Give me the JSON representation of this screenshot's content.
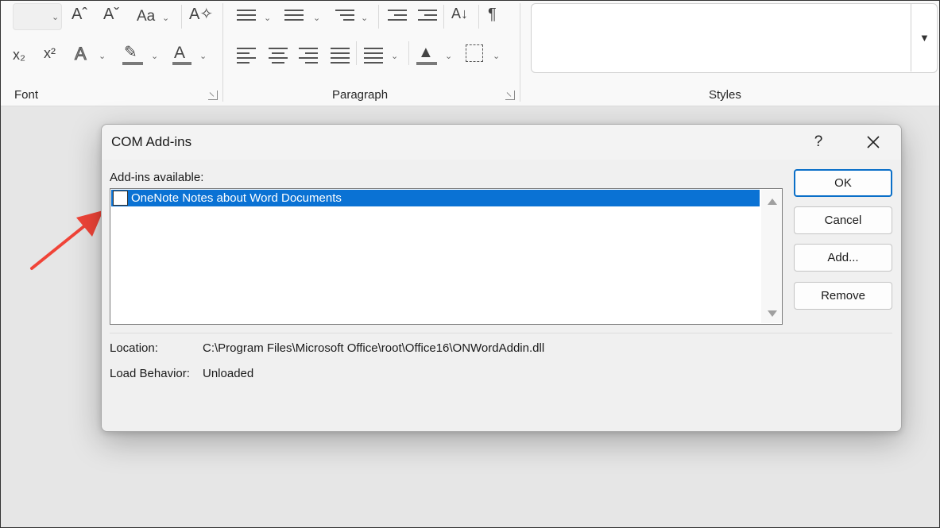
{
  "ribbon": {
    "groups": {
      "font": "Font",
      "paragraph": "Paragraph",
      "styles": "Styles"
    },
    "glyphs": {
      "grow_font": "Aˆ",
      "shrink_font": "Aˇ",
      "change_case": "Aa",
      "subscript": "x₂",
      "superscript": "x²",
      "text_effects": "A",
      "font_color": "A",
      "sort": "A↓",
      "pilcrow": "¶"
    },
    "colors": {
      "highlight": "#ffff00",
      "font_color": "#e60000",
      "shading": "#bdbdbd"
    }
  },
  "dialog": {
    "title": "COM Add-ins",
    "help": "?",
    "available_label": "Add-ins available:",
    "items": [
      {
        "label": "OneNote Notes about Word Documents",
        "checked": false,
        "selected": true
      }
    ],
    "buttons": {
      "ok": "OK",
      "cancel": "Cancel",
      "add": "Add...",
      "remove": "Remove"
    },
    "location_label": "Location:",
    "location_value": "C:\\Program Files\\Microsoft Office\\root\\Office16\\ONWordAddin.dll",
    "load_behavior_label": "Load Behavior:",
    "load_behavior_value": "Unloaded"
  },
  "annotation": {
    "arrow_color": "#f04438"
  }
}
